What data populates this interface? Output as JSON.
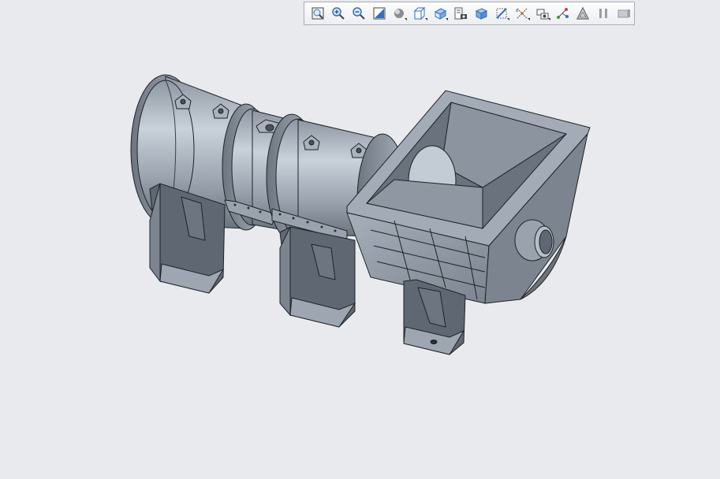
{
  "toolbar": {
    "buttons": [
      {
        "icon": "zoom-to-fit-icon"
      },
      {
        "icon": "zoom-in-icon"
      },
      {
        "icon": "zoom-out-icon"
      },
      {
        "icon": "zoom-window-icon"
      },
      {
        "icon": "display-style-icon",
        "flyout": true
      },
      {
        "icon": "standard-view-icon",
        "flyout": true
      },
      {
        "icon": "view-orientation-icon",
        "flyout": true
      },
      {
        "icon": "snapshot-icon"
      },
      {
        "icon": "hidden-line-icon"
      },
      {
        "icon": "section-view-icon",
        "flyout": true
      },
      {
        "icon": "datum-display-icon",
        "flyout": true
      },
      {
        "icon": "appearance-icon",
        "flyout": true
      },
      {
        "icon": "show-relations-icon"
      },
      {
        "icon": "perspective-icon"
      },
      {
        "icon": "pause-icon"
      },
      {
        "icon": "spin-center-icon"
      }
    ]
  },
  "colors": {
    "background": "#e8eaed",
    "model_light": "#b7c0ca",
    "model_mid": "#8f98a3",
    "model_dark": "#5d6570",
    "edge": "#1e2226"
  },
  "model": {
    "label": "3d-assembly-pump-duct"
  }
}
